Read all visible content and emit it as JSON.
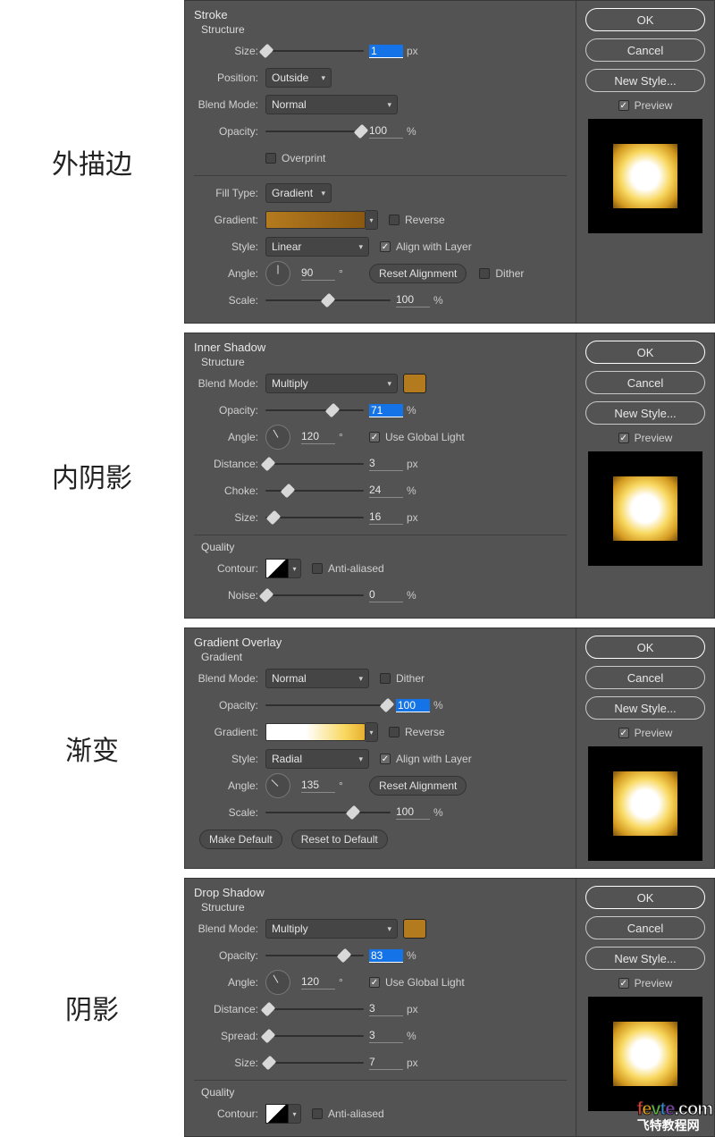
{
  "labels_cn": {
    "stroke": "外描边",
    "inner": "内阴影",
    "gradient": "渐变",
    "drop": "阴影"
  },
  "common_buttons": {
    "ok": "OK",
    "cancel": "Cancel",
    "new_style": "New Style...",
    "preview": "Preview"
  },
  "units": {
    "px": "px",
    "pct": "%",
    "deg": "°"
  },
  "shared_labels": {
    "structure": "Structure",
    "quality": "Quality",
    "gradient_sub": "Gradient",
    "size": "Size:",
    "position": "Position:",
    "blend_mode": "Blend Mode:",
    "opacity": "Opacity:",
    "overprint": "Overprint",
    "fill_type": "Fill Type:",
    "gradient": "Gradient:",
    "reverse": "Reverse",
    "style": "Style:",
    "align_layer": "Align with Layer",
    "angle": "Angle:",
    "reset_align": "Reset Alignment",
    "dither": "Dither",
    "scale": "Scale:",
    "use_global": "Use Global Light",
    "distance": "Distance:",
    "choke": "Choke:",
    "spread": "Spread:",
    "contour": "Contour:",
    "anti": "Anti-aliased",
    "noise": "Noise:",
    "make_default": "Make Default",
    "reset_default": "Reset to Default"
  },
  "stroke": {
    "title": "Stroke",
    "size": 1,
    "size_pct": 1,
    "position": "Outside",
    "blend_mode": "Normal",
    "opacity": 100,
    "opacity_pct": 97,
    "overprint": false,
    "fill_type": "Gradient",
    "reverse": false,
    "style": "Linear",
    "align_layer": true,
    "angle": 90,
    "dither": false,
    "scale": 100,
    "scale_pct": 50
  },
  "inner": {
    "title": "Inner Shadow",
    "blend_mode": "Multiply",
    "color": "#b47a1e",
    "opacity": 71,
    "opacity_pct": 68,
    "angle": 120,
    "use_global": true,
    "distance": 3,
    "distance_pct": 3,
    "choke": 24,
    "choke_pct": 23,
    "size": 16,
    "size_pct": 8,
    "anti": false,
    "noise": 0,
    "noise_pct": 1
  },
  "gradient": {
    "title": "Gradient Overlay",
    "blend_mode": "Normal",
    "dither": false,
    "opacity": 100,
    "opacity_pct": 97,
    "reverse": false,
    "style": "Radial",
    "align_layer": true,
    "angle": 135,
    "scale": 100,
    "scale_pct": 70
  },
  "drop": {
    "title": "Drop Shadow",
    "blend_mode": "Multiply",
    "color": "#b47a1e",
    "opacity": 83,
    "opacity_pct": 80,
    "angle": 120,
    "use_global": true,
    "distance": 3,
    "distance_pct": 3,
    "spread": 3,
    "spread_pct": 3,
    "size": 7,
    "size_pct": 4,
    "anti": false
  },
  "watermark": {
    "domain": ".com",
    "sub": "飞特教程网"
  }
}
